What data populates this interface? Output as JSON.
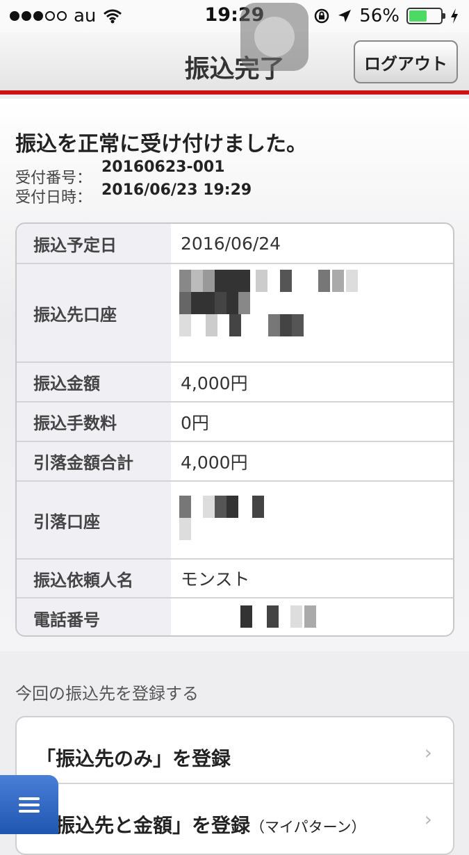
{
  "status": {
    "carrier": "au",
    "time": "19:29",
    "battery_percent_text": "56%",
    "battery_level": 0.56
  },
  "nav": {
    "title": "振込完了",
    "logout_label": "ログアウト"
  },
  "result": {
    "message": "振込を正常に受け付けました。",
    "receipt_no_label": "受付番号：",
    "receipt_no": "20160623-001",
    "receipt_time_label": "受付日時：",
    "receipt_time": "2016/06/23 19:29"
  },
  "details": [
    {
      "label": "振込予定日",
      "value": "2016/06/24"
    },
    {
      "label": "振込先口座",
      "value": ""
    },
    {
      "label": "振込金額",
      "value": "4,000円"
    },
    {
      "label": "振込手数料",
      "value": "0円"
    },
    {
      "label": "引落金額合計",
      "value": "4,000円"
    },
    {
      "label": "引落口座",
      "value": ""
    },
    {
      "label": "振込依頼人名",
      "value": "モンスト"
    },
    {
      "label": "電話番号",
      "value": ""
    }
  ],
  "register": {
    "heading": "今回の振込先を登録する",
    "items": [
      {
        "label": "「振込先のみ」を登録",
        "note": ""
      },
      {
        "label": "「振込先と金額」を登録",
        "note": "（マイパターン）"
      }
    ]
  },
  "colors": {
    "accent_red": "#cc1414",
    "menu_blue": "#2a63c2",
    "battery_green": "#4cd964"
  }
}
